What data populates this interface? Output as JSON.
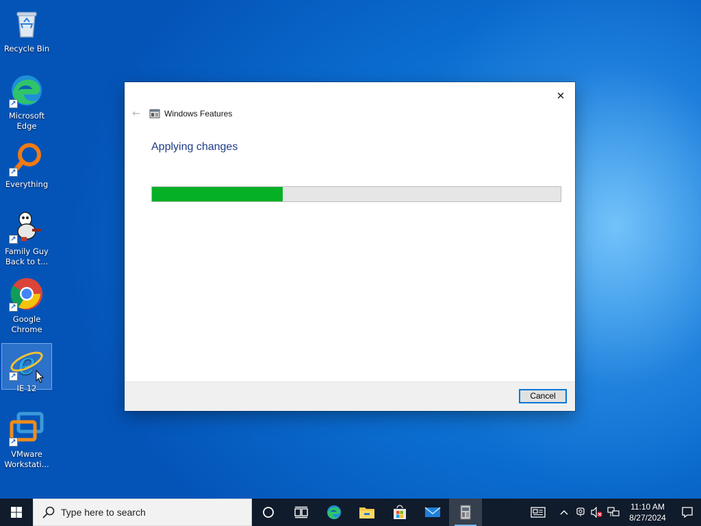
{
  "desktop": {
    "icons": [
      {
        "label": "Recycle Bin"
      },
      {
        "label": "Microsoft Edge"
      },
      {
        "label": "Everything"
      },
      {
        "label": "Family Guy Back to t..."
      },
      {
        "label": "Google Chrome"
      },
      {
        "label": "IE 12"
      },
      {
        "label": "VMware Workstati..."
      }
    ]
  },
  "dialog": {
    "title": "Windows Features",
    "heading": "Applying changes",
    "progress_percent": 32,
    "cancel_label": "Cancel"
  },
  "taskbar": {
    "search_placeholder": "Type here to search",
    "pinned": [
      "cortana-icon",
      "task-view-icon",
      "edge-icon",
      "file-explorer-icon",
      "store-icon",
      "mail-icon",
      "windows-features-icon"
    ],
    "clock_time": "11:10 AM",
    "clock_date": "8/27/2024"
  },
  "colors": {
    "progress_fill": "#06b025",
    "heading_blue": "#1d3a87",
    "taskbar_bg": "#101b2b",
    "focus_blue": "#0078d7"
  }
}
